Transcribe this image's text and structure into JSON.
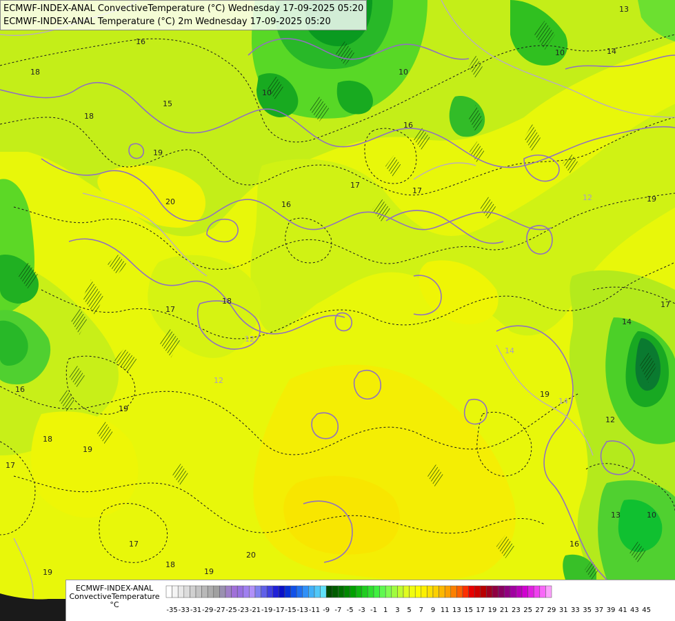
{
  "title": {
    "line1": "ECMWF-INDEX-ANAL ConvectiveTemperature (°C) Wednesday 17-09-2025 05:20",
    "line2": "ECMWF-INDEX-ANAL Temperature (°C) 2m Wednesday 17-09-2025 05:20"
  },
  "legend": {
    "model": "ECMWF-INDEX-ANAL",
    "parameter": "ConvectiveTemperature",
    "unit": "°C",
    "tick_labels": [
      "-35",
      "-33",
      "-31",
      "-29",
      "-27",
      "-25",
      "-23",
      "-21",
      "-19",
      "-17",
      "-15",
      "-13",
      "-11",
      "-9",
      "-7",
      "-5",
      "-3",
      "-1",
      "1",
      "3",
      "5",
      "7",
      "9",
      "11",
      "13",
      "15",
      "17",
      "19",
      "21",
      "23",
      "25",
      "27",
      "29",
      "31",
      "33",
      "35",
      "37",
      "39",
      "41",
      "43",
      "45"
    ],
    "colors": [
      "#ffffff",
      "#f4f4f4",
      "#e8e8e8",
      "#dcdcdc",
      "#d0d0d0",
      "#c4c4c4",
      "#b8b8b8",
      "#acacac",
      "#a0a0a0",
      "#9a90b0",
      "#a080c8",
      "#a070d8",
      "#9870e0",
      "#a080f0",
      "#b090f8",
      "#8080f0",
      "#6060e8",
      "#4040e0",
      "#2020d8",
      "#0a10c8",
      "#0830d8",
      "#1050e8",
      "#2070f0",
      "#3090f8",
      "#40b0f8",
      "#50c8f8",
      "#60e0f8",
      "#004a00",
      "#005c00",
      "#007000",
      "#008800",
      "#00a000",
      "#10b810",
      "#20cc20",
      "#30e030",
      "#40f040",
      "#60f850",
      "#80fc50",
      "#a0fc40",
      "#c0fc30",
      "#e0fc20",
      "#f0fc10",
      "#fcfc00",
      "#fcf000",
      "#fce000",
      "#fcd000",
      "#fcb800",
      "#fca000",
      "#fc8000",
      "#fc6000",
      "#fc3000",
      "#e80000",
      "#d00000",
      "#b80000",
      "#a00020",
      "#900040",
      "#880060",
      "#900080",
      "#a000a0",
      "#b800b8",
      "#d000d0",
      "#e020e0",
      "#f040f0",
      "#f868f8",
      "#fca0fc"
    ],
    "accent_green": "#28c828",
    "background_yellow": "#e8f70a"
  },
  "map": {
    "contour_labels": [
      {
        "text": "16"
      },
      {
        "text": "18"
      },
      {
        "text": "18"
      },
      {
        "text": "15"
      },
      {
        "text": "19"
      },
      {
        "text": "20"
      },
      {
        "text": "16"
      },
      {
        "text": "17"
      },
      {
        "text": "17"
      },
      {
        "text": "18"
      },
      {
        "text": "12"
      },
      {
        "text": "17"
      },
      {
        "text": "16"
      },
      {
        "text": "12"
      },
      {
        "text": "19"
      },
      {
        "text": "18"
      },
      {
        "text": "19"
      },
      {
        "text": "17"
      },
      {
        "text": "14"
      },
      {
        "text": "19"
      },
      {
        "text": "14"
      },
      {
        "text": "12"
      },
      {
        "text": "17"
      },
      {
        "text": "14"
      },
      {
        "text": "12"
      },
      {
        "text": "16"
      },
      {
        "text": "13"
      },
      {
        "text": "10"
      },
      {
        "text": "18"
      },
      {
        "text": "20"
      },
      {
        "text": "19"
      },
      {
        "text": "17"
      },
      {
        "text": "19"
      },
      {
        "text": "10"
      },
      {
        "text": "10"
      },
      {
        "text": "10"
      },
      {
        "text": "13"
      },
      {
        "text": "14"
      },
      {
        "text": "16"
      },
      {
        "text": "19"
      }
    ]
  }
}
